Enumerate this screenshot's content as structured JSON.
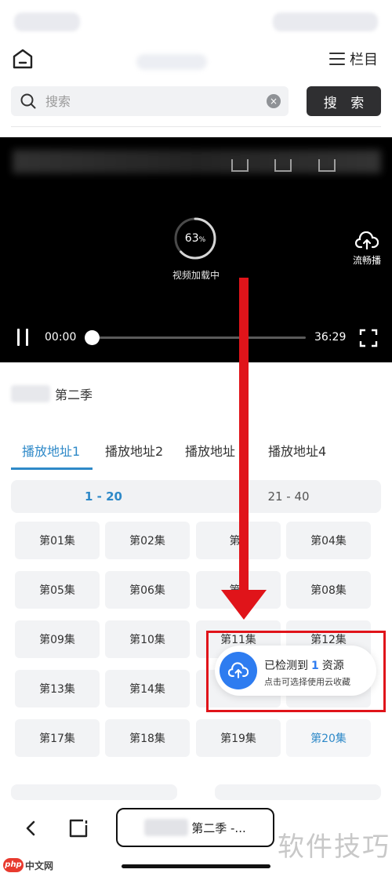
{
  "header": {
    "menu_label": "栏目"
  },
  "search": {
    "placeholder": "搜索",
    "button_label": "搜 索",
    "clear_glyph": "×"
  },
  "player": {
    "loading_percent": "63",
    "percent_sign": "%",
    "loading_fraction": 0.63,
    "loading_label": "视频加载中",
    "smooth_label": "流畅播",
    "current_time": "00:00",
    "total_time": "36:29"
  },
  "series": {
    "title_suffix": "第二季"
  },
  "tabs": [
    {
      "label": "播放地址1"
    },
    {
      "label": "播放地址2"
    },
    {
      "label": "播放地址"
    },
    {
      "label": "播放地址4"
    }
  ],
  "ranges": [
    {
      "label": "1 - 20"
    },
    {
      "label": "21 - 40"
    }
  ],
  "episodes": [
    "第01集",
    "第02集",
    "第0",
    "第04集",
    "第05集",
    "第06集",
    "第0",
    "第08集",
    "第09集",
    "第10集",
    "第11集",
    "第12集",
    "第13集",
    "第14集",
    "",
    "",
    "第17集",
    "第18集",
    "第19集",
    "第20集"
  ],
  "toast": {
    "title_prefix": "已检测到",
    "count": "1",
    "title_suffix": "资源",
    "subtitle": "点击可选择使用云收藏"
  },
  "bottom": {
    "url_text": "第二季 -...",
    "watermark": "软件技巧",
    "logo_badge": "php",
    "logo_text": "中文网"
  },
  "colors": {
    "accent": "#2e89c8",
    "annotation_red": "#e0141a",
    "toast_blue": "#2e7cf0"
  }
}
